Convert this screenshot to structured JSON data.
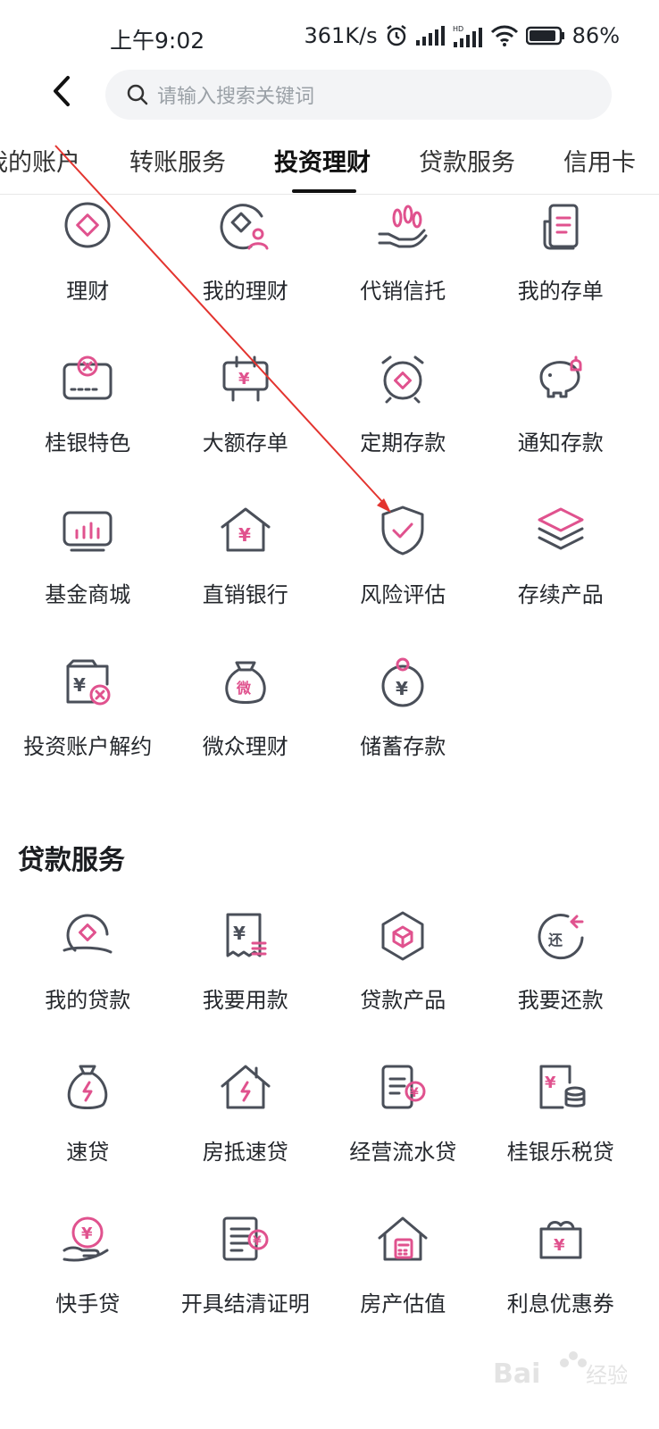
{
  "status_bar": {
    "time": "上午9:02",
    "speed": "361K/s",
    "battery": "86%"
  },
  "search": {
    "placeholder": "请输入搜索关键词"
  },
  "tabs": [
    {
      "label": "我的账户"
    },
    {
      "label": "转账服务"
    },
    {
      "label": "投资理财",
      "active": true
    },
    {
      "label": "贷款服务"
    },
    {
      "label": "信用卡"
    }
  ],
  "invest": {
    "items": [
      {
        "label": "理财",
        "icon": "wealth-icon"
      },
      {
        "label": "我的理财",
        "icon": "my-wealth-icon"
      },
      {
        "label": "代销信托",
        "icon": "trust-icon"
      },
      {
        "label": "我的存单",
        "icon": "deposit-receipt-icon"
      },
      {
        "label": "桂银特色",
        "icon": "featured-icon"
      },
      {
        "label": "大额存单",
        "icon": "large-cd-icon"
      },
      {
        "label": "定期存款",
        "icon": "fixed-deposit-icon"
      },
      {
        "label": "通知存款",
        "icon": "piggy-bank-icon"
      },
      {
        "label": "基金商城",
        "icon": "fund-mall-icon"
      },
      {
        "label": "直销银行",
        "icon": "direct-bank-icon"
      },
      {
        "label": "风险评估",
        "icon": "shield-check-icon"
      },
      {
        "label": "存续产品",
        "icon": "layers-icon"
      },
      {
        "label": "投资账户解约",
        "icon": "account-cancel-icon"
      },
      {
        "label": "微众理财",
        "icon": "webank-bag-icon"
      },
      {
        "label": "储蓄存款",
        "icon": "savings-icon"
      }
    ]
  },
  "loan": {
    "title": "贷款服务",
    "items": [
      {
        "label": "我的贷款",
        "icon": "my-loan-icon"
      },
      {
        "label": "我要用款",
        "icon": "withdraw-loan-icon"
      },
      {
        "label": "贷款产品",
        "icon": "loan-product-icon"
      },
      {
        "label": "我要还款",
        "icon": "repay-icon"
      },
      {
        "label": "速贷",
        "icon": "quick-loan-icon"
      },
      {
        "label": "房抵速贷",
        "icon": "house-mortgage-icon"
      },
      {
        "label": "经营流水贷",
        "icon": "business-flow-icon"
      },
      {
        "label": "桂银乐税贷",
        "icon": "tax-loan-icon"
      },
      {
        "label": "快手贷",
        "icon": "hand-coin-icon"
      },
      {
        "label": "开具结清证明",
        "icon": "certificate-icon"
      },
      {
        "label": "房产估值",
        "icon": "house-calc-icon"
      },
      {
        "label": "利息优惠券",
        "icon": "coupon-icon"
      }
    ]
  },
  "colors": {
    "accent": "#e0528e",
    "icon_stroke": "#4a4f59",
    "annotation_arrow": "#e3342f"
  },
  "watermark": "Baidu经验"
}
